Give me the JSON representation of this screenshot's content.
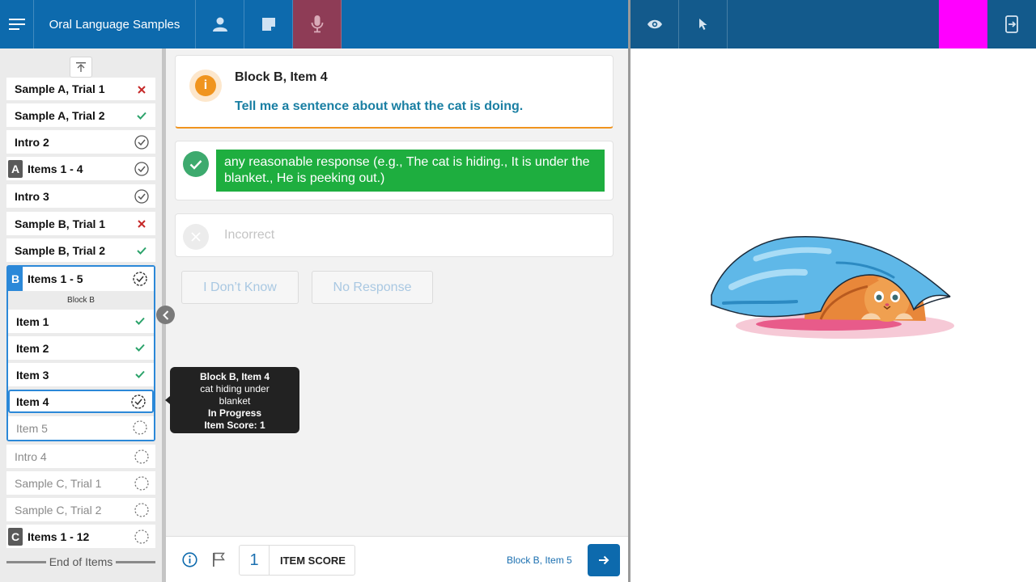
{
  "app": {
    "title": "Oral Language Samples"
  },
  "toolbar": {
    "icons": [
      "menu-icon",
      "person-icon",
      "note-icon",
      "microphone-icon"
    ],
    "right_icons": [
      "eye-icon",
      "pointer-icon",
      "exit-panel-icon"
    ],
    "active_color": "#8e3c56",
    "highlight_color": "#ff00ff"
  },
  "sidebar": {
    "items_top": [
      {
        "label": "Sample A, Trial 1",
        "status": "incorrect"
      },
      {
        "label": "Sample A, Trial 2",
        "status": "correct"
      },
      {
        "label": "Intro 2",
        "status": "complete"
      },
      {
        "badge": "A",
        "label": "Items 1 - 4",
        "status": "complete"
      },
      {
        "label": "Intro 3",
        "status": "complete"
      },
      {
        "label": "Sample B, Trial 1",
        "status": "incorrect"
      },
      {
        "label": "Sample B, Trial 2",
        "status": "correct"
      }
    ],
    "group_b": {
      "badge": "B",
      "label": "Items 1 - 5",
      "sub_title": "Block B",
      "items": [
        {
          "label": "Item 1",
          "status": "correct"
        },
        {
          "label": "Item 2",
          "status": "correct"
        },
        {
          "label": "Item 3",
          "status": "correct"
        },
        {
          "label": "Item 4",
          "status": "in-progress"
        },
        {
          "label": "Item 5",
          "status": "not-started"
        }
      ]
    },
    "items_bottom": [
      {
        "label": "Intro 4",
        "status": "not-started"
      },
      {
        "label": "Sample C, Trial 1",
        "status": "not-started"
      },
      {
        "label": "Sample C, Trial 2",
        "status": "not-started"
      },
      {
        "badge": "C",
        "label": "Items 1 - 12",
        "status": "not-started"
      }
    ],
    "end_label": "End of Items"
  },
  "tooltip": {
    "title": "Block B, Item 4",
    "line1": "cat hiding under",
    "line2": "blanket",
    "status": "In Progress",
    "score": "Item Score: 1"
  },
  "item": {
    "title": "Block B, Item 4",
    "prompt": "Tell me a sentence about what the cat is doing.",
    "correct_response": "any reasonable response (e.g., The cat is hiding., It is under the blanket., He is peeking out.)",
    "incorrect_label": "Incorrect",
    "dont_know_label": "I Don’t Know",
    "no_response_label": "No Response"
  },
  "footer": {
    "score_value": "1",
    "score_label": "ITEM SCORE",
    "next_item": "Block B, Item 5"
  },
  "colors": {
    "primary": "#0d6aad",
    "correct_green": "#1eae3f",
    "warning_orange": "#f0941e",
    "error_red": "#c62828",
    "check_teal": "#2ca36b"
  }
}
